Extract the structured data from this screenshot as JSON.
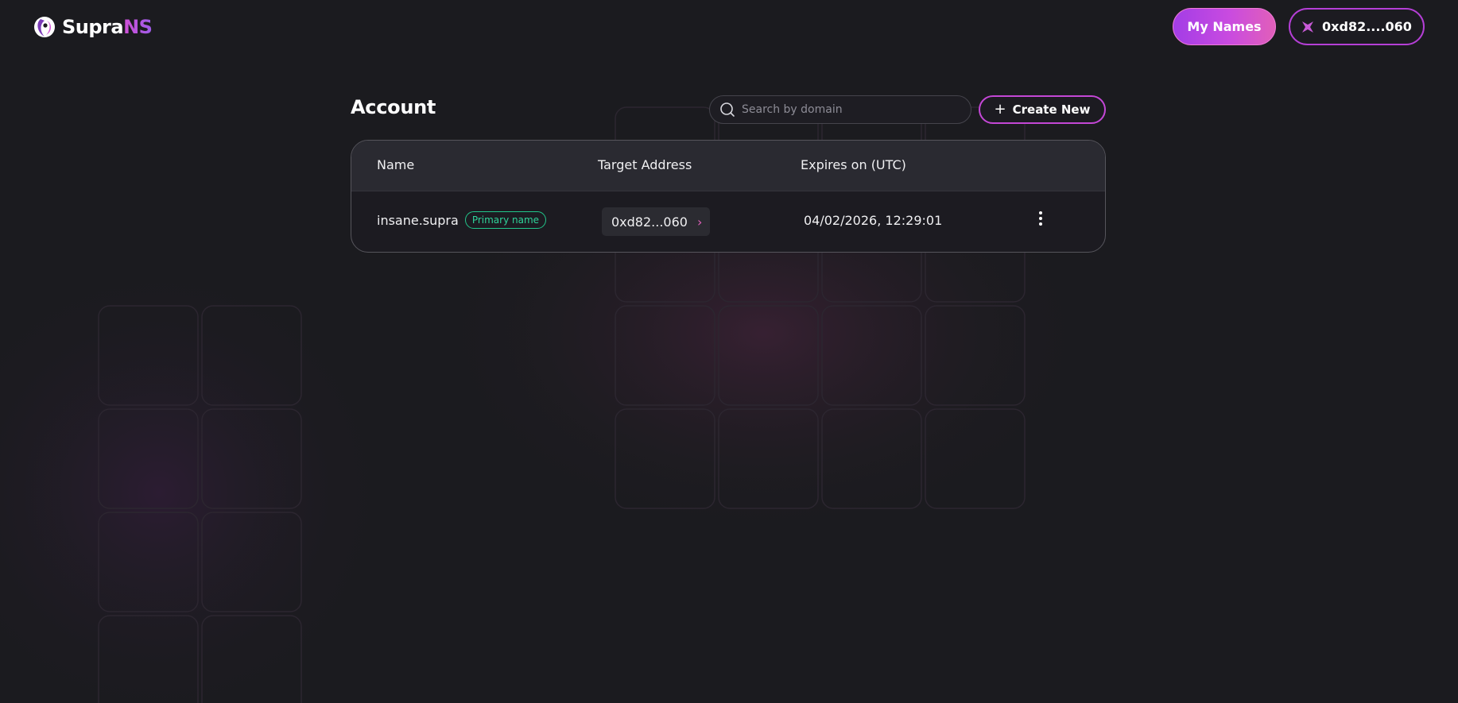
{
  "brand": {
    "name_primary": "Supra",
    "name_accent": "NS"
  },
  "header": {
    "my_names_label": "My Names",
    "wallet_label": "0xd82....060"
  },
  "page": {
    "title": "Account"
  },
  "search": {
    "placeholder": "Search by domain",
    "value": ""
  },
  "actions": {
    "create_new_label": "Create New"
  },
  "table": {
    "columns": [
      "Name",
      "Target Address",
      "Expires on (UTC)"
    ],
    "rows": [
      {
        "name": "insane.supra",
        "badge": "Primary name",
        "target_address": "0xd82...060",
        "expires": "04/02/2026, 12:29:01"
      }
    ]
  },
  "icons": {
    "logo": "supra-logo-icon",
    "wallet": "supra-star-icon",
    "search": "search-icon",
    "plus": "plus-icon",
    "chevron": "chevron-right-icon",
    "more": "more-vertical-icon"
  },
  "colors": {
    "background": "#1b1b1f",
    "accent_purple": "#a33de6",
    "accent_pink": "#e15fb9",
    "badge_green": "#2fd49a"
  }
}
